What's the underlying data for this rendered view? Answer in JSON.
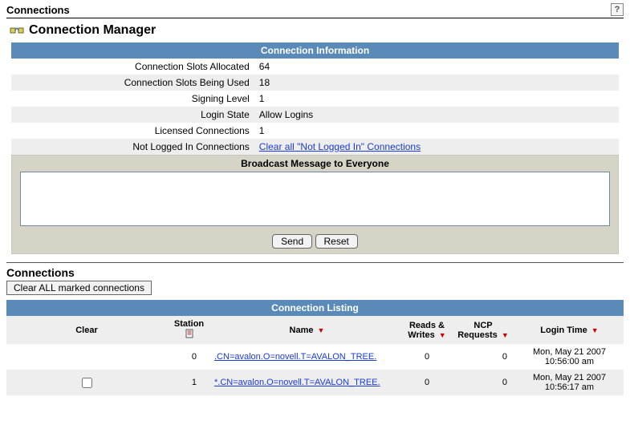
{
  "header": {
    "title": "Connections",
    "help_icon_label": "?"
  },
  "manager": {
    "heading": "Connection Manager"
  },
  "info_section": {
    "band_title": "Connection Information",
    "rows": {
      "slots_allocated": {
        "label": "Connection Slots Allocated",
        "value": "64"
      },
      "slots_used": {
        "label": "Connection Slots Being Used",
        "value": "18"
      },
      "signing_level": {
        "label": "Signing Level",
        "value": "1"
      },
      "login_state": {
        "label": "Login State",
        "value": "Allow Logins"
      },
      "licensed": {
        "label": "Licensed Connections",
        "value": "1"
      },
      "not_logged_in": {
        "label": "Not Logged In Connections",
        "link_text": "Clear all \"Not Logged In\" Connections"
      }
    }
  },
  "broadcast": {
    "title": "Broadcast Message to Everyone",
    "value": "",
    "send_label": "Send",
    "reset_label": "Reset"
  },
  "connections": {
    "heading": "Connections",
    "clear_all_label": "Clear ALL marked connections",
    "band_title": "Connection Listing",
    "columns": {
      "clear": "Clear",
      "station": "Station",
      "name": "Name",
      "reads_writes": "Reads & Writes",
      "ncp": "NCP Requests",
      "login_time": "Login Time"
    },
    "rows": [
      {
        "show_checkbox": false,
        "station": "0",
        "name": ".CN=avalon.O=novell.T=AVALON_TREE.",
        "reads_writes": "0",
        "ncp": "0",
        "login_date": "Mon, May 21 2007",
        "login_time": "10:56:00 am"
      },
      {
        "show_checkbox": true,
        "station": "1",
        "name": "*.CN=avalon.O=novell.T=AVALON_TREE.",
        "reads_writes": "0",
        "ncp": "0",
        "login_date": "Mon, May 21 2007",
        "login_time": "10:56:17 am"
      }
    ]
  }
}
